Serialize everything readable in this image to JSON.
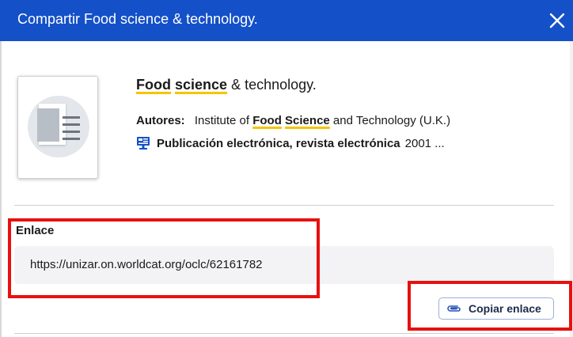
{
  "dialog": {
    "title": "Compartir Food science & technology.",
    "close_icon": "close-icon"
  },
  "record": {
    "title_part1": "Food",
    "title_part2": "science",
    "title_rest": " & technology.",
    "authors_label": "Autores:",
    "author_prefix": "Institute of ",
    "author_hl1": "Food",
    "author_hl2": "Science",
    "author_suffix": " and Technology (U.K.)",
    "format_icon": "computer-monitor-icon",
    "format_label": "Publicación electrónica, revista electrónica",
    "format_year": "2001 ..."
  },
  "link": {
    "label": "Enlace",
    "url": "https://unizar.on.worldcat.org/oclc/62161782"
  },
  "actions": {
    "copy_label": "Copiar enlace",
    "copy_icon": "paperclip-icon"
  },
  "colors": {
    "header_bg": "#1450c8",
    "highlight": "#f5c400",
    "annotation_red": "#e81010"
  }
}
